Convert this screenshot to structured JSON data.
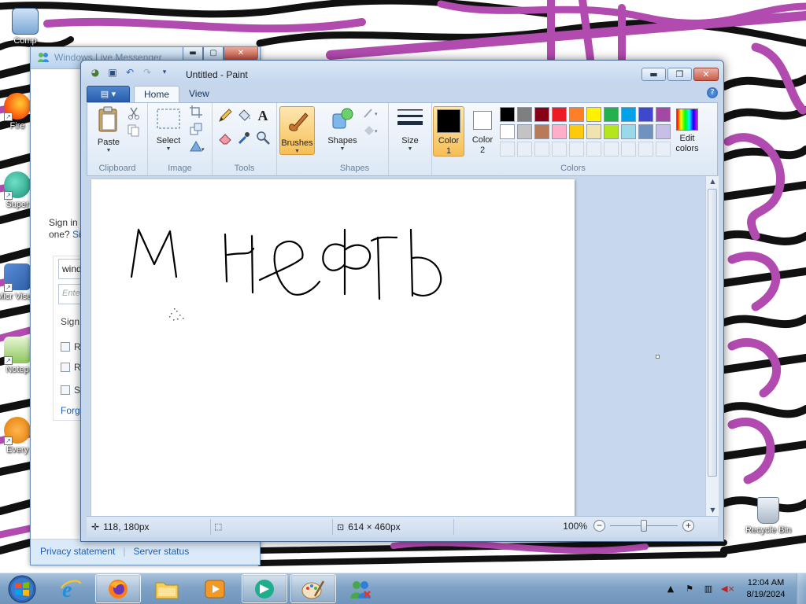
{
  "desktop": {
    "icons": [
      {
        "label": "Computer",
        "short": "Comp"
      },
      {
        "label": "Firefox",
        "short": "Fire"
      },
      {
        "label": "Super",
        "short": "Super"
      },
      {
        "label": "Microsoft Visual",
        "short": "Micr Visual"
      },
      {
        "label": "Notepad",
        "short": "Notep"
      },
      {
        "label": "Everything",
        "short": "Every"
      },
      {
        "label": "Recycle Bin",
        "short": "Recycle Bin"
      }
    ]
  },
  "messenger": {
    "title": "Windows Live Messenger",
    "sign_in_text_line1": "Sign in",
    "sign_in_text_line2_prefix": "one? ",
    "sign_in_text_line2_link": "Sig",
    "email_value": "wind",
    "password_placeholder": "Enter",
    "status_label": "Sign i",
    "options": [
      "R",
      "R",
      "Si"
    ],
    "forgot": "Forgo",
    "footer": {
      "privacy": "Privacy statement",
      "server": "Server status"
    }
  },
  "paint": {
    "title": "Untitled - Paint",
    "file_button": "▤ ▾",
    "tabs": [
      {
        "label": "Home",
        "active": true
      },
      {
        "label": "View",
        "active": false
      }
    ],
    "groups": {
      "clipboard": {
        "label": "Clipboard",
        "paste": "Paste"
      },
      "image": {
        "label": "Image",
        "select": "Select"
      },
      "tools": {
        "label": "Tools"
      },
      "brushes": {
        "label": "Brushes"
      },
      "shapes": {
        "label": "Shapes",
        "shapes_btn": "Shapes"
      },
      "size": {
        "label": "Size"
      },
      "colors": {
        "label": "Colors",
        "color1": "Color 1",
        "color1_a": "Color",
        "color1_b": "1",
        "color2_a": "Color",
        "color2_b": "2",
        "edit_a": "Edit",
        "edit_b": "colors"
      }
    },
    "palette_row1": [
      "#000000",
      "#7f7f7f",
      "#880015",
      "#ed1c24",
      "#ff7f27",
      "#fff200",
      "#22b14c",
      "#00a2e8",
      "#3f48cc",
      "#a349a4"
    ],
    "palette_row2": [
      "#ffffff",
      "#c3c3c3",
      "#b97a57",
      "#ffaec9",
      "#ffc90e",
      "#efe4b0",
      "#b5e61d",
      "#99d9ea",
      "#7092be",
      "#c8bfe7"
    ],
    "color1_value": "#000000",
    "color2_value": "#ffffff",
    "canvas_text": "М нефть",
    "status": {
      "cursor_pos": "118, 180px",
      "image_size": "614 × 460px",
      "zoom": "100%",
      "zoom_fraction": 0.5
    }
  },
  "taskbar": {
    "clock_time": "12:04 AM",
    "clock_date": "8/19/2024",
    "items": [
      "Internet Explorer",
      "Firefox",
      "Windows Explorer",
      "Media Player",
      "Windows Live Messenger",
      "Paint",
      "Users"
    ]
  }
}
